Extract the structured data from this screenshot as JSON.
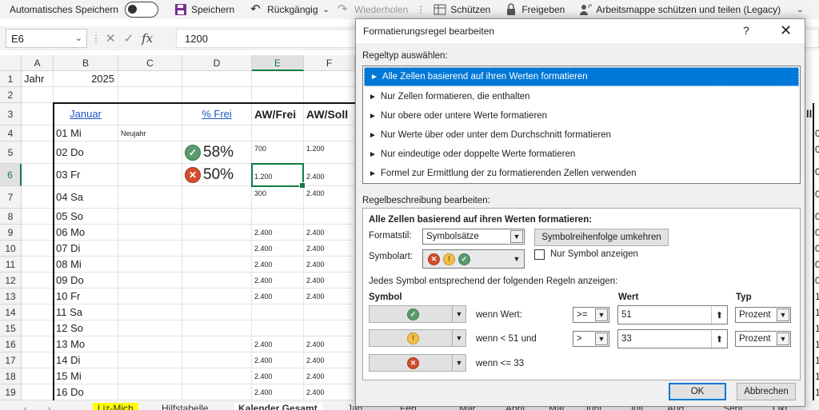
{
  "toolbar": {
    "autosave_label": "Automatisches Speichern",
    "save_label": "Speichern",
    "undo_label": "Rückgängig",
    "redo_label": "Wiederholen",
    "protect_label": "Schützen",
    "share_label": "Freigeben",
    "share_legacy_label": "Arbeitsmappe schützen und teilen (Legacy)"
  },
  "formula_bar": {
    "name_box": "E6",
    "fx": "fx",
    "value": "1200"
  },
  "columns": [
    "A",
    "B",
    "C",
    "D",
    "E",
    "F"
  ],
  "rows": [
    "1",
    "2",
    "3",
    "4",
    "5",
    "6",
    "7",
    "8",
    "9",
    "10",
    "11",
    "12",
    "13",
    "14",
    "15",
    "16",
    "17",
    "18",
    "19"
  ],
  "cells": {
    "a1": "Jahr",
    "b1": "2025",
    "b3": "Januar",
    "d3": "% Frei",
    "e3": "AW/Frei",
    "f3": "AW/Soll",
    "b_days": [
      "01 Mi",
      "02 Do",
      "03 Fr",
      "04 Sa",
      "05 So",
      "06 Mo",
      "07 Di",
      "08 Mi",
      "09 Do",
      "10 Fr",
      "11 Sa",
      "12 So",
      "13 Mo",
      "14 Di",
      "15 Mi",
      "16 Do"
    ],
    "c4": "Neujahr",
    "d5": "58%",
    "d6": "50%",
    "e_values": [
      "",
      "700",
      "1.200",
      "300",
      "",
      "2.400",
      "2.400",
      "2.400",
      "2.400",
      "2.400",
      "",
      "",
      "2.400",
      "2.400",
      "2.400",
      "2.400"
    ],
    "f_values": [
      "",
      "1.200",
      "2.400",
      "2.400",
      "",
      "2.400",
      "2.400",
      "2.400",
      "2.400",
      "2.400",
      "",
      "",
      "2.400",
      "2.400",
      "2.400",
      "2.400"
    ]
  },
  "right_edge": {
    "hdr": "ll",
    "vals": [
      "0",
      "0",
      "0",
      "0",
      "0",
      "0",
      "0",
      "0",
      "0",
      "1",
      "1",
      "1",
      "1",
      "1",
      "1",
      "1"
    ]
  },
  "sheet_tabs": [
    "Liz-Mich",
    "Hilfstabelle",
    "Kalender Gesamt",
    "Jan",
    "Feb",
    "Mär",
    "April",
    "Mai",
    "Juni",
    "Juli",
    "Aug",
    "Sept",
    "Okt"
  ],
  "dialog": {
    "title": "Formatierungsregel bearbeiten",
    "help": "?",
    "close": "✕",
    "select_type_label": "Regeltyp auswählen:",
    "rule_types": [
      "Alle Zellen basierend auf ihren Werten formatieren",
      "Nur Zellen formatieren, die enthalten",
      "Nur obere oder untere Werte formatieren",
      "Nur Werte über oder unter dem Durchschnitt formatieren",
      "Nur eindeutige oder doppelte Werte formatieren",
      "Formel zur Ermittlung der zu formatierenden Zellen verwenden"
    ],
    "edit_desc_label": "Regelbeschreibung bearbeiten:",
    "desc_heading": "Alle Zellen basierend auf ihren Werten formatieren:",
    "format_style_label": "Formatstil:",
    "format_style_value": "Symbolsätze",
    "reverse_button": "Symbolreihenfolge umkehren",
    "icon_style_label": "Symbolart:",
    "show_icon_only_label": "Nur Symbol anzeigen",
    "rules_intro": "Jedes Symbol entsprechend der folgenden Regeln anzeigen:",
    "col_symbol": "Symbol",
    "col_value": "Wert",
    "col_type": "Typ",
    "rules": [
      {
        "icon": "green-check-icon",
        "condition": "wenn Wert:",
        "operator": ">=",
        "value": "51",
        "type": "Prozent"
      },
      {
        "icon": "yellow-exclamation-icon",
        "condition": "wenn < 51 und",
        "operator": ">",
        "value": "33",
        "type": "Prozent"
      },
      {
        "icon": "red-x-icon",
        "condition": "wenn <= 33"
      }
    ],
    "ok": "OK",
    "cancel": "Abbrechen"
  }
}
